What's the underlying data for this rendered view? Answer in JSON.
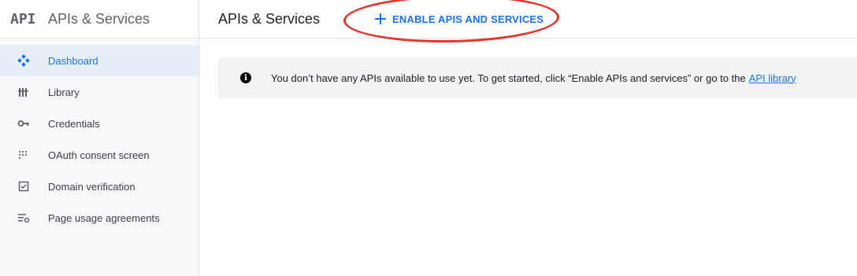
{
  "sidebar": {
    "logo_text": "API",
    "product_title": "APIs & Services",
    "items": [
      {
        "label": "Dashboard",
        "icon": "dashboard-icon",
        "active": true
      },
      {
        "label": "Library",
        "icon": "library-icon",
        "active": false
      },
      {
        "label": "Credentials",
        "icon": "key-icon",
        "active": false
      },
      {
        "label": "OAuth consent screen",
        "icon": "oauth-icon",
        "active": false
      },
      {
        "label": "Domain verification",
        "icon": "checkbox-icon",
        "active": false
      },
      {
        "label": "Page usage agreements",
        "icon": "settings-list-icon",
        "active": false
      }
    ]
  },
  "header": {
    "title": "APIs & Services",
    "enable_button_label": "ENABLE APIS AND SERVICES",
    "enable_button_icon": "plus-icon"
  },
  "notice": {
    "text": "You don’t have any APIs available to use yet. To get started, click “Enable APIs and services” or go to the",
    "link_text": "API library",
    "icon": "info-icon"
  },
  "colors": {
    "accent": "#1a73e8",
    "annotation": "#e8312a",
    "active_bg": "#e8eef8",
    "notice_bg": "#f1f3f4"
  }
}
